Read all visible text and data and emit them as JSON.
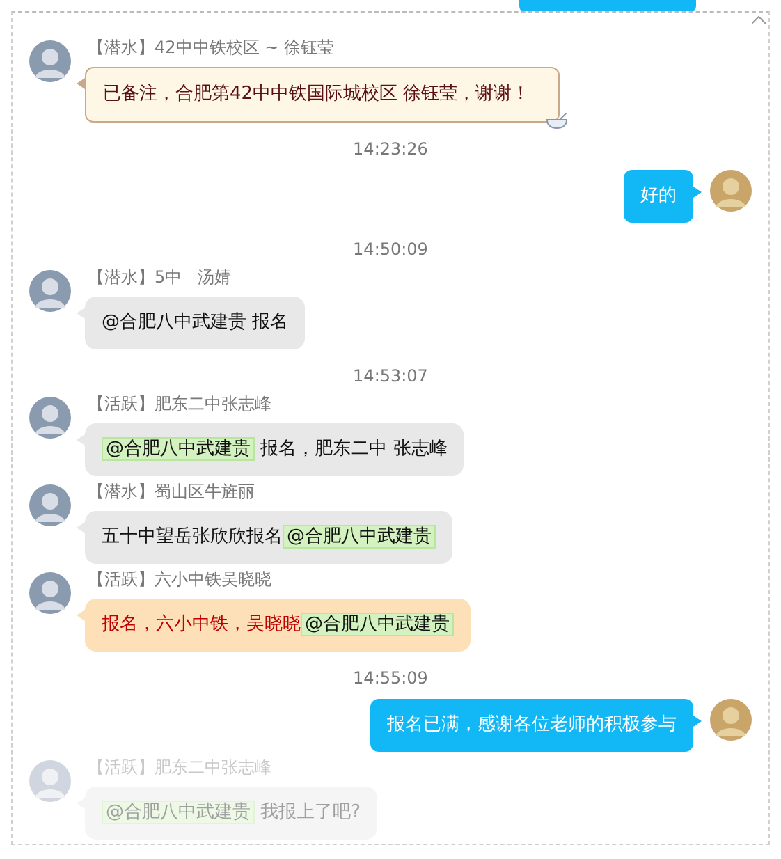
{
  "items": [
    {
      "kind": "note",
      "role": "【潜水】",
      "name": "42中中铁校区 ~ 徐钰莹",
      "faded": false,
      "parts": [
        {
          "text": "已备注，合肥第42中中铁国际城校区 徐钰莹，谢谢！",
          "mention": false
        }
      ]
    },
    {
      "kind": "time",
      "text": "14:23:26"
    },
    {
      "kind": "outgoing",
      "parts": [
        {
          "text": "好的",
          "mention": false
        }
      ]
    },
    {
      "kind": "time",
      "text": "14:50:09"
    },
    {
      "kind": "incoming",
      "role": "【潜水】",
      "name": "5中   汤婧",
      "faded": false,
      "parts": [
        {
          "text": "@合肥八中武建贵 报名",
          "mention": false
        }
      ]
    },
    {
      "kind": "time",
      "text": "14:53:07"
    },
    {
      "kind": "incoming",
      "role": "【活跃】",
      "name": "肥东二中张志峰",
      "faded": false,
      "parts": [
        {
          "text": "@合肥八中武建贵",
          "mention": true
        },
        {
          "text": " 报名，肥东二中 张志峰",
          "mention": false
        }
      ]
    },
    {
      "kind": "incoming",
      "role": "【潜水】",
      "name": "蜀山区牛旌丽",
      "faded": false,
      "parts": [
        {
          "text": "五十中望岳张欣欣报名",
          "mention": false
        },
        {
          "text": "@合肥八中武建贵",
          "mention": true
        }
      ]
    },
    {
      "kind": "highlight",
      "role": "【活跃】",
      "name": "六小中铁吴晓晓",
      "faded": false,
      "parts": [
        {
          "text": "报名，六小中铁，吴晓晓",
          "mention": false
        },
        {
          "text": "@合肥八中武建贵",
          "mention": true
        }
      ]
    },
    {
      "kind": "time",
      "text": "14:55:09"
    },
    {
      "kind": "outgoing",
      "parts": [
        {
          "text": "报名已满，感谢各位老师的积极参与",
          "mention": false
        }
      ]
    },
    {
      "kind": "incoming",
      "role": "【活跃】",
      "name": "肥东二中张志峰",
      "faded": true,
      "parts": [
        {
          "text": "@合肥八中武建贵",
          "mention": true
        },
        {
          "text": " 我报上了吧?",
          "mention": false
        }
      ]
    }
  ]
}
